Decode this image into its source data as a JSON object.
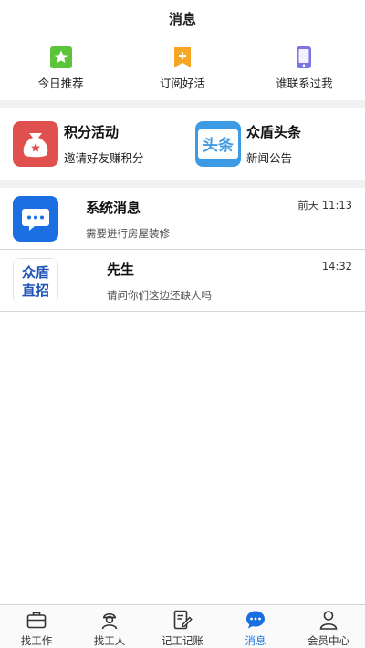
{
  "header": {
    "title": "消息"
  },
  "shortcuts": [
    {
      "label": "今日推荐",
      "icon": "star-icon",
      "color": "#5cc43a"
    },
    {
      "label": "订阅好活",
      "icon": "bookmark-plus-icon",
      "color": "#f5a623"
    },
    {
      "label": "谁联系过我",
      "icon": "phone-icon",
      "color": "#7b74e6"
    }
  ],
  "promos": [
    {
      "title": "积分活动",
      "subtitle": "邀请好友赚积分",
      "icon": "money-bag-icon",
      "color": "#e0504e"
    },
    {
      "title": "众盾头条",
      "subtitle": "新闻公告",
      "icon": "headline-icon",
      "icon_text": "头条",
      "color": "#3d9be6"
    }
  ],
  "messages": [
    {
      "title": "系统消息",
      "subtitle": "需要进行房屋装修",
      "time": "前天 11:13",
      "icon": "chat-bubble-icon",
      "color": "#1b6fe2"
    },
    {
      "title": "先生",
      "subtitle": "请问你们这边还缺人吗",
      "time": "14:32",
      "icon": "logo-icon",
      "logo_text_1": "众盾",
      "logo_text_2": "直招",
      "color": "#1f55b7"
    }
  ],
  "tabs": [
    {
      "label": "找工作",
      "icon": "briefcase-icon",
      "active": false
    },
    {
      "label": "找工人",
      "icon": "worker-icon",
      "active": false
    },
    {
      "label": "记工记账",
      "icon": "notebook-pen-icon",
      "active": false
    },
    {
      "label": "消息",
      "icon": "chat-icon",
      "active": true
    },
    {
      "label": "会员中心",
      "icon": "user-icon",
      "active": false
    }
  ]
}
